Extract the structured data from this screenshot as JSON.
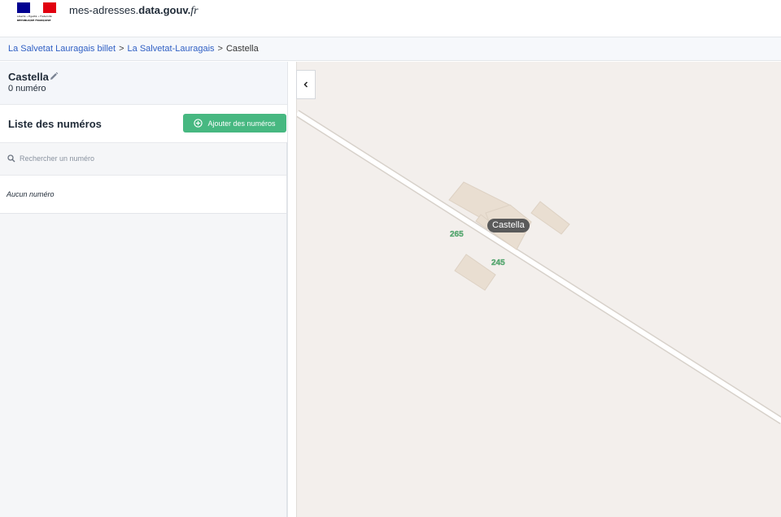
{
  "header": {
    "logo": {
      "name": "republique-francaise-logo",
      "flag_colors": [
        "#000091",
        "#ffffff",
        "#e1000f"
      ],
      "text_line1": "Liberté • Égalité • Fraternité",
      "text_line2": "RÉPUBLIQUE FRANÇAISE"
    },
    "site_name_prefix": "mes-adresses.",
    "site_name_bold": "data.gouv.",
    "site_name_suffix": "fr"
  },
  "breadcrumb": {
    "items": [
      "La Salvetat Lauragais billet",
      "La Salvetat-Lauragais",
      "Castella"
    ],
    "separator": ">"
  },
  "voie": {
    "title": "Castella",
    "count": "0 numéro",
    "edit_icon": "pencil-icon"
  },
  "numeros": {
    "title": "Liste des numéros",
    "add_button_label": "Ajouter des numéros",
    "add_icon": "plus-circle-icon",
    "search_placeholder": "Rechercher un numéro",
    "search_value": "",
    "empty_text": "Aucun numéro"
  },
  "map": {
    "collapse_icon": "chevron-left-icon",
    "place_label": "Castella",
    "road_labels": [
      "265",
      "245"
    ],
    "colors": {
      "background": "#f3efec",
      "building": "#e8ddd0",
      "road_casing": "#d9d3cc",
      "road_fill": "#ffffff",
      "road_number": "#5fb37a"
    }
  },
  "colors": {
    "accent_green": "#47b881",
    "link_blue": "#2f5fc4"
  }
}
